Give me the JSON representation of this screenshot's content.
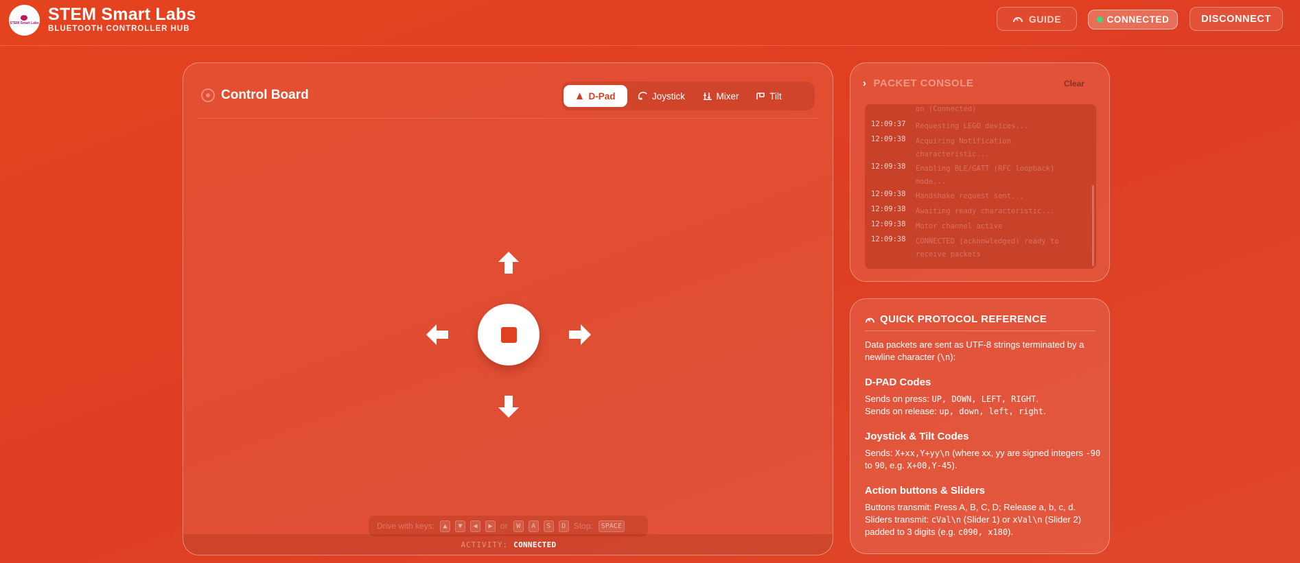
{
  "header": {
    "logo_text": "STEM Smart Labs",
    "title": "STEM Smart Labs",
    "subtitle": "BLUETOOTH CONTROLLER HUB",
    "guide_label": "GUIDE",
    "status_label": "CONNECTED",
    "disconnect_label": "DISCONNECT"
  },
  "board": {
    "title": "Control Board",
    "tabs": [
      {
        "label": "D-Pad",
        "active": true
      },
      {
        "label": "Joystick",
        "active": false
      },
      {
        "label": "Mixer",
        "active": false
      },
      {
        "label": "Tilt",
        "active": false
      }
    ],
    "keys_hint": {
      "prefix": "Drive with keys:",
      "arrows": [
        "▲",
        "▼",
        "◀",
        "▶"
      ],
      "or": "or",
      "letters": [
        "W",
        "A",
        "S",
        "D"
      ],
      "stop_prefix": "Stop:",
      "stop_key": "SPACE"
    },
    "activity_label": "ACTIVITY:",
    "activity_value": "CONNECTED"
  },
  "console": {
    "title": "PACKET CONSOLE",
    "clear_label": "Clear",
    "top_partial": "on (Connected)",
    "entries": [
      {
        "time": "12:09:37",
        "msg": "Requesting LEGO devices..."
      },
      {
        "time": "12:09:38",
        "msg": "Acquiring Notification characteristic..."
      },
      {
        "time": "12:09:38",
        "msg": "Enabling BLE/GATT (RFC loopback) mode..."
      },
      {
        "time": "12:09:38",
        "msg": "Handshake request sent..."
      },
      {
        "time": "12:09:38",
        "msg": "Awaiting ready characteristic..."
      },
      {
        "time": "12:09:38",
        "msg": "Motor channel active"
      },
      {
        "time": "12:09:38",
        "msg": "CONNECTED (acknowledged) ready to receive packets"
      }
    ]
  },
  "reference": {
    "title": "QUICK PROTOCOL REFERENCE",
    "intro_a": "Data packets are sent as UTF-8 strings terminated by a newline character (",
    "intro_code": "\\n",
    "intro_b": "):",
    "dpad_title": "D-PAD Codes",
    "dpad_press_a": "Sends on press: ",
    "dpad_press_codes": "UP, DOWN, LEFT, RIGHT",
    "dpad_press_b": ".",
    "dpad_release_a": "Sends on release: ",
    "dpad_release_codes": "up, down, left, right",
    "dpad_release_b": ".",
    "joy_title": "Joystick & Tilt Codes",
    "joy_a": "Sends: ",
    "joy_code": "X+xx,Y+yy\\n",
    "joy_b": " (where xx, yy are signed integers ",
    "joy_min": "-90",
    "joy_c": " to ",
    "joy_max": "90",
    "joy_d": ", e.g. ",
    "joy_eg": "X+00,Y-45",
    "joy_e": ").",
    "action_title": "Action buttons & Sliders",
    "action_a": "Buttons transmit: Press A, B, C, D; Release a, b, c, d.",
    "slider_a": "Sliders transmit: ",
    "slider_code1": "cVal\\n",
    "slider_b": " (Slider 1) or ",
    "slider_code2": "xVal\\n",
    "slider_c": " (Slider 2) padded to 3 digits (e.g. ",
    "slider_eg": "c090, x180",
    "slider_d": ")."
  },
  "colors": {
    "background": "#e0421f",
    "accent": "#e04020",
    "status_led": "#39d98a"
  },
  "icons": [
    "logo",
    "gauge-icon",
    "led-icon",
    "target-icon",
    "dpad-icon",
    "joystick-icon",
    "mixer-icon",
    "tilt-icon",
    "arrow-up-icon",
    "arrow-down-icon",
    "arrow-left-icon",
    "arrow-right-icon",
    "stop-icon",
    "chevron-right-icon"
  ]
}
